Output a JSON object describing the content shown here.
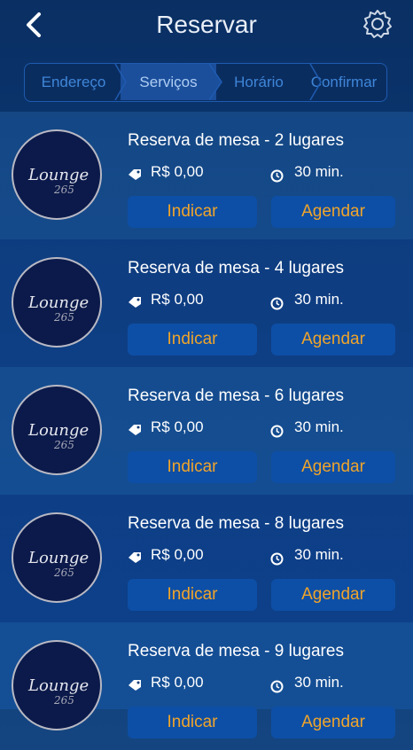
{
  "header": {
    "title": "Reservar"
  },
  "steps": [
    {
      "label": "Endereço",
      "active": false
    },
    {
      "label": "Serviços",
      "active": true
    },
    {
      "label": "Horário",
      "active": false
    },
    {
      "label": "Confirmar",
      "active": false
    }
  ],
  "services": [
    {
      "title": "Reserva de mesa - 2 lugares",
      "price": "R$ 0,00",
      "duration": "30 min.",
      "indicar": "Indicar",
      "agendar": "Agendar",
      "logo_text": "Lounge",
      "logo_sub": "265"
    },
    {
      "title": "Reserva de mesa - 4 lugares",
      "price": "R$ 0,00",
      "duration": "30 min.",
      "indicar": "Indicar",
      "agendar": "Agendar",
      "logo_text": "Lounge",
      "logo_sub": "265"
    },
    {
      "title": "Reserva de mesa - 6 lugares",
      "price": "R$ 0,00",
      "duration": "30 min.",
      "indicar": "Indicar",
      "agendar": "Agendar",
      "logo_text": "Lounge",
      "logo_sub": "265"
    },
    {
      "title": "Reserva de mesa - 8 lugares",
      "price": "R$ 0,00",
      "duration": "30 min.",
      "indicar": "Indicar",
      "agendar": "Agendar",
      "logo_text": "Lounge",
      "logo_sub": "265"
    },
    {
      "title": "Reserva de mesa - 9 lugares",
      "price": "R$ 0,00",
      "duration": "30 min.",
      "indicar": "Indicar",
      "agendar": "Agendar",
      "logo_text": "Lounge",
      "logo_sub": "265"
    }
  ],
  "colors": {
    "accent": "#f0a42a",
    "button": "#0d4fa6",
    "step_active": "#1b4f9c"
  },
  "icons": {
    "back": "chevron-left-icon",
    "settings": "gear-icon",
    "price": "tag-icon",
    "duration": "clock-icon"
  }
}
